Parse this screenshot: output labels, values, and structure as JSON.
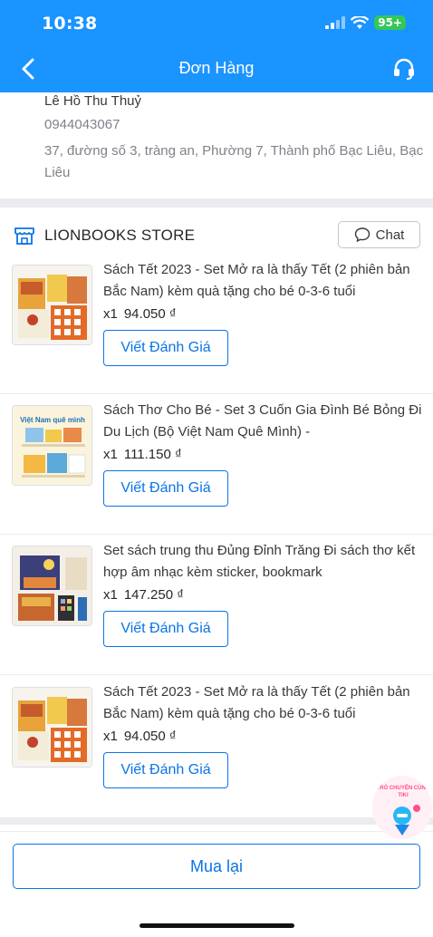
{
  "status_bar": {
    "time": "10:38",
    "battery": "95+"
  },
  "nav": {
    "title": "Đơn Hàng",
    "back_icon": "chevron-left-icon",
    "support_icon": "headset-icon"
  },
  "address": {
    "name": "Lê Hồ Thu Thuỷ",
    "phone": "0944043067",
    "line": "37, đường số 3, tràng an, Phường 7, Thành phố Bạc Liêu, Bạc Liêu"
  },
  "store": {
    "name": "LIONBOOKS STORE",
    "chat_label": "Chat",
    "icon": "store-icon"
  },
  "items": [
    {
      "title": "Sách Tết 2023 - Set Mở ra là thấy Tết (2 phiên bản Bắc Nam) kèm quà tặng cho bé 0-3-6 tuổi",
      "qty": "x1",
      "price": "94.050 ₫",
      "review_label": "Viết Đánh Giá"
    },
    {
      "title": "Sách Thơ Cho Bé - Set 3 Cuốn Gia Đình Bé Bỏng Đi Du Lịch (Bộ Việt Nam Quê Mình) -",
      "qty": "x1",
      "price": "111.150 ₫",
      "review_label": "Viết Đánh Giá",
      "thumb_text": "Việt Nam quê mình"
    },
    {
      "title": "Set sách trung thu Đủng Đỉnh Trăng Đi sách thơ kết hợp âm nhạc kèm sticker, bookmark",
      "qty": "x1",
      "price": "147.250 ₫",
      "review_label": "Viết Đánh Giá"
    },
    {
      "title": "Sách Tết 2023 - Set Mở ra là thấy Tết (2 phiên bản Bắc Nam) kèm quà tặng cho bé 0-3-6 tuổi",
      "qty": "x1",
      "price": "94.050 ₫",
      "review_label": "Viết Đánh Giá"
    }
  ],
  "chat_bubble": {
    "text": "TRÒ CHUYỆN CÙNG TIKI"
  },
  "footer": {
    "rebuy_label": "Mua lại"
  },
  "colors": {
    "primary": "#1a94ff",
    "link": "#0b74e5",
    "divider": "#ebebf0"
  }
}
